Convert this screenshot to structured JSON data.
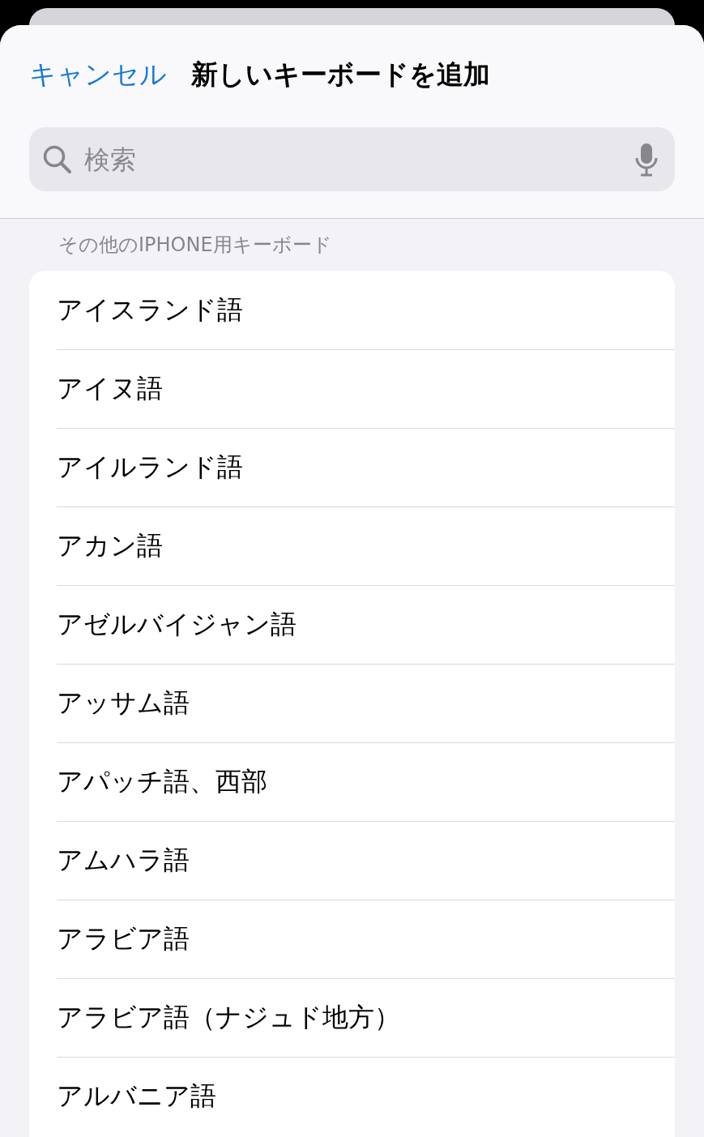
{
  "header": {
    "cancel": "キャンセル",
    "title": "新しいキーボードを追加"
  },
  "search": {
    "placeholder": "検索"
  },
  "section": {
    "title": "その他のIPHONE用キーボード"
  },
  "keyboards": [
    {
      "label": "アイスランド語"
    },
    {
      "label": "アイヌ語"
    },
    {
      "label": "アイルランド語"
    },
    {
      "label": "アカン語"
    },
    {
      "label": "アゼルバイジャン語"
    },
    {
      "label": "アッサム語"
    },
    {
      "label": "アパッチ語、西部"
    },
    {
      "label": "アムハラ語"
    },
    {
      "label": "アラビア語"
    },
    {
      "label": "アラビア語（ナジュド地方）"
    },
    {
      "label": "アルバニア語"
    }
  ]
}
